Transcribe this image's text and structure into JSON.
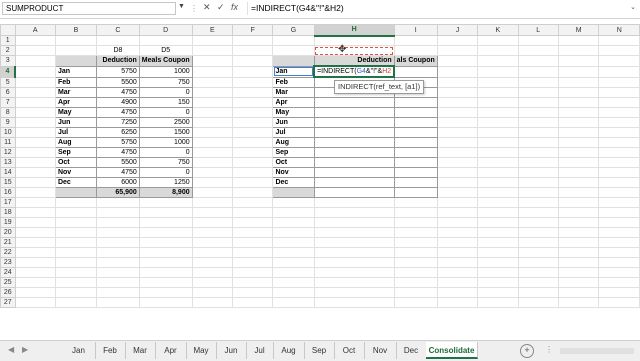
{
  "formula_bar": {
    "name_box": "SUMPRODUCT",
    "cancel_glyph": "✕",
    "enter_glyph": "✓",
    "fx_label": "fx",
    "formula": "=INDIRECT(G4&\"!\"&H2)"
  },
  "columns": [
    "A",
    "B",
    "C",
    "D",
    "E",
    "F",
    "G",
    "H",
    "I",
    "J",
    "K",
    "L",
    "M",
    "N"
  ],
  "rows": [
    "1",
    "2",
    "3",
    "4",
    "5",
    "6",
    "7",
    "8",
    "9",
    "10",
    "11",
    "12",
    "13",
    "14",
    "15",
    "16",
    "17",
    "18",
    "19",
    "20",
    "21",
    "22",
    "23",
    "24",
    "25",
    "26",
    "27"
  ],
  "left_table": {
    "refs": {
      "c": "D8",
      "d": "D5"
    },
    "headers": {
      "deduction": "Deduction",
      "meals": "Meals Coupon"
    },
    "rows": [
      {
        "month": "Jan",
        "deduction": "5750",
        "meals": "1000"
      },
      {
        "month": "Feb",
        "deduction": "5500",
        "meals": "750"
      },
      {
        "month": "Mar",
        "deduction": "4750",
        "meals": "0"
      },
      {
        "month": "Apr",
        "deduction": "4900",
        "meals": "150"
      },
      {
        "month": "May",
        "deduction": "4750",
        "meals": "0"
      },
      {
        "month": "Jun",
        "deduction": "7250",
        "meals": "2500"
      },
      {
        "month": "Jul",
        "deduction": "6250",
        "meals": "1500"
      },
      {
        "month": "Aug",
        "deduction": "5750",
        "meals": "1000"
      },
      {
        "month": "Sep",
        "deduction": "4750",
        "meals": "0"
      },
      {
        "month": "Oct",
        "deduction": "5500",
        "meals": "750"
      },
      {
        "month": "Nov",
        "deduction": "4750",
        "meals": "0"
      },
      {
        "month": "Dec",
        "deduction": "6000",
        "meals": "1250"
      }
    ],
    "totals": {
      "deduction": "65,900",
      "meals": "8,900"
    }
  },
  "right_table": {
    "headers": {
      "h": "Deduction",
      "i": "als Coupon"
    },
    "editing_cell": {
      "prefix": "=INDIRECT(",
      "ref1": "G4",
      "middle": "&\"!\"&",
      "ref2": "H2"
    },
    "months": [
      "Jan",
      "Feb",
      "Mar",
      "Apr",
      "May",
      "Jun",
      "Jul",
      "Aug",
      "Sep",
      "Oct",
      "Nov",
      "Dec"
    ]
  },
  "tooltip": {
    "text": "INDIRECT(ref_text, [a1])"
  },
  "sheet_tabs": [
    {
      "label": "Jan"
    },
    {
      "label": "Feb"
    },
    {
      "label": "Mar"
    },
    {
      "label": "Apr"
    },
    {
      "label": "May"
    },
    {
      "label": "Jun"
    },
    {
      "label": "Jul"
    },
    {
      "label": "Aug"
    },
    {
      "label": "Sep"
    },
    {
      "label": "Oct"
    },
    {
      "label": "Nov"
    },
    {
      "label": "Dec"
    },
    {
      "label": "Consolidate"
    }
  ],
  "tab_nav": {
    "prev": "◀",
    "next": "▶",
    "add": "+",
    "more": "⋮"
  },
  "colors": {
    "accent": "#217346",
    "header_fill": "#d9d9d9",
    "ref_blue": "#3162c7",
    "ref_red": "#d0402f"
  }
}
